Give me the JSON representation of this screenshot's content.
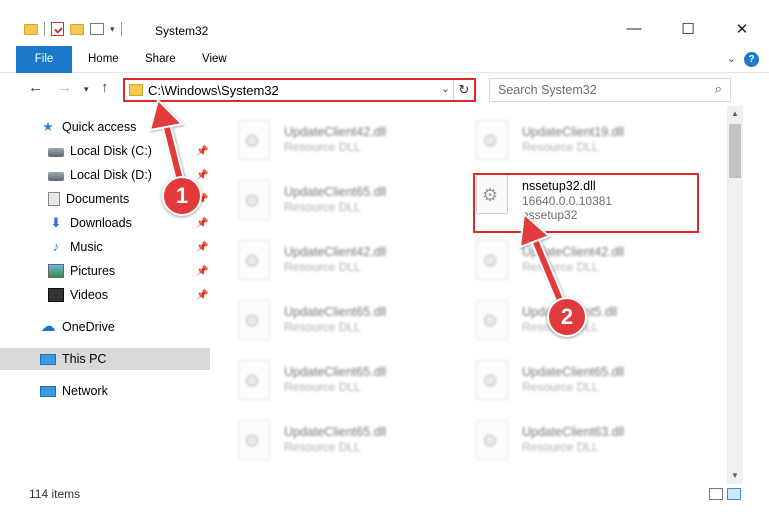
{
  "window": {
    "title": "System32",
    "minimize": "—",
    "maximize": "☐",
    "close": "✕"
  },
  "ribbon": {
    "tabs": [
      "File",
      "Home",
      "Share",
      "View"
    ],
    "help": "?"
  },
  "address": {
    "path": "C:\\Windows\\System32",
    "search_placeholder": "Search System32"
  },
  "sidebar": {
    "items": [
      {
        "label": "Quick access",
        "icon": "star-icon",
        "pinned": false
      },
      {
        "label": "Local Disk (C:)",
        "icon": "disk-icon",
        "pinned": true
      },
      {
        "label": "Local Disk (D:)",
        "icon": "disk-icon",
        "pinned": true
      },
      {
        "label": "Documents",
        "icon": "documents-icon",
        "pinned": true
      },
      {
        "label": "Downloads",
        "icon": "download-icon",
        "pinned": true
      },
      {
        "label": "Music",
        "icon": "music-icon",
        "pinned": true
      },
      {
        "label": "Pictures",
        "icon": "pictures-icon",
        "pinned": true
      },
      {
        "label": "Videos",
        "icon": "videos-icon",
        "pinned": true
      },
      {
        "label": "OneDrive",
        "icon": "cloud-icon",
        "pinned": false
      },
      {
        "label": "This PC",
        "icon": "computer-icon",
        "pinned": false,
        "selected": true
      },
      {
        "label": "Network",
        "icon": "network-icon",
        "pinned": false
      }
    ]
  },
  "files": [
    {
      "name": "UpdateClient42.dll",
      "line1": "Resource DLL",
      "line2": ""
    },
    {
      "name": "UpdateClient19.dll",
      "line1": "Resource DLL",
      "line2": ""
    },
    {
      "name": "UpdateClient65.dll",
      "line1": "Resource DLL",
      "line2": ""
    },
    {
      "name": "nssetup32.dll",
      "line1": "16640.0.0.10381",
      "line2": "nssetup32"
    },
    {
      "name": "UpdateClient42.dll",
      "line1": "Resource DLL",
      "line2": ""
    },
    {
      "name": "UpdateClient42.dll",
      "line1": "Resource DLL",
      "line2": ""
    },
    {
      "name": "UpdateClient65.dll",
      "line1": "Resource DLL",
      "line2": ""
    },
    {
      "name": "UpdateClient5.dll",
      "line1": "Resource DLL",
      "line2": ""
    },
    {
      "name": "UpdateClient65.dll",
      "line1": "Resource DLL",
      "line2": ""
    },
    {
      "name": "UpdateClient65.dll",
      "line1": "Resource DLL",
      "line2": ""
    },
    {
      "name": "UpdateClient65.dll",
      "line1": "Resource DLL",
      "line2": ""
    },
    {
      "name": "UpdateClient63.dll",
      "line1": "Resource DLL",
      "line2": ""
    }
  ],
  "status": {
    "item_count": "114 items"
  },
  "annotations": {
    "step1": "1",
    "step2": "2",
    "color": "#e02828"
  }
}
